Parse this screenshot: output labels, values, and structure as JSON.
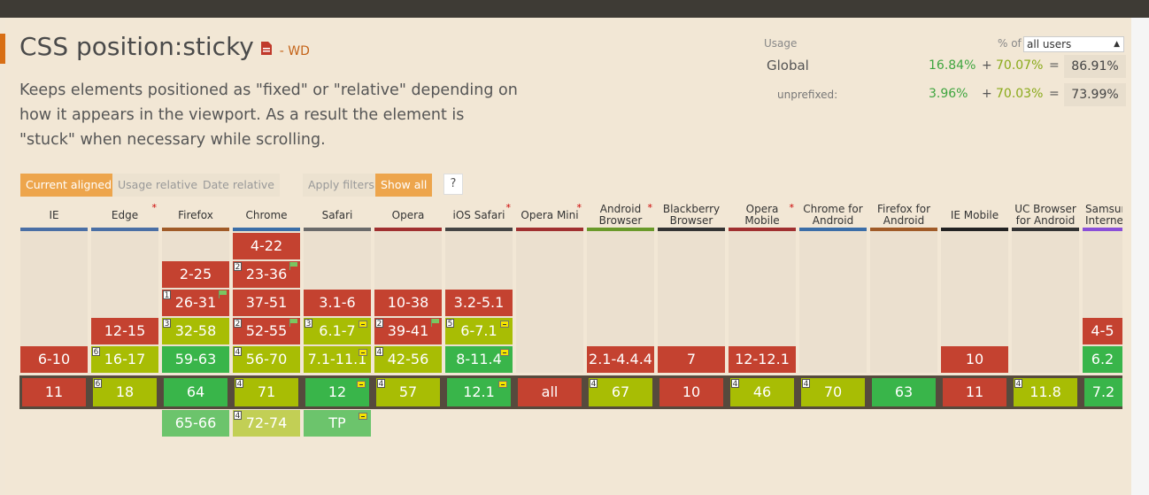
{
  "feature": {
    "title": "CSS position:sticky",
    "status": "- WD",
    "description": "Keeps elements positioned as \"fixed\" or \"relative\" depending on how it appears in the viewport. As a result the element is \"stuck\" when necessary while scrolling."
  },
  "usage": {
    "label": "Usage",
    "pct_of": "% of",
    "select_value": "all users",
    "global": {
      "name": "Global",
      "full": "16.84%",
      "plus": "+",
      "partial": "70.07%",
      "eq": "=",
      "total": "86.91%"
    },
    "unprefixed": {
      "name": "unprefixed:",
      "full": "3.96%",
      "plus": "+",
      "partial": "70.03%",
      "eq": "=",
      "total": "73.99%"
    }
  },
  "toolbar": {
    "current_aligned": "Current aligned",
    "usage_relative": "Usage relative",
    "date_relative": "Date relative",
    "apply_filters": "Apply filters",
    "show_all": "Show all",
    "help": "?"
  },
  "colors": {
    "supported": "#39b54a",
    "partial": "#a8bd04",
    "unsupported": "#c44230",
    "accent": "#eda54c"
  },
  "browsers": [
    {
      "name": "IE",
      "asterisk": false,
      "color": "#4a6fa5",
      "cells": [
        {
          "row": 4,
          "v": "6-10",
          "c": "r"
        }
      ],
      "current": {
        "v": "11",
        "c": "r"
      },
      "future": []
    },
    {
      "name": "Edge",
      "asterisk": true,
      "color": "#4a6fa5",
      "cells": [
        {
          "row": 3,
          "v": "12-15",
          "c": "r"
        },
        {
          "row": 4,
          "v": "16-17",
          "c": "y",
          "note": "6"
        }
      ],
      "current": {
        "v": "18",
        "c": "y",
        "note": "6"
      },
      "future": []
    },
    {
      "name": "Firefox",
      "asterisk": false,
      "color": "#a05b28",
      "cells": [
        {
          "row": 1,
          "v": "2-25",
          "c": "r"
        },
        {
          "row": 2,
          "v": "26-31",
          "c": "r",
          "note": "1",
          "flag": true
        },
        {
          "row": 3,
          "v": "32-58",
          "c": "y",
          "note": "3"
        },
        {
          "row": 4,
          "v": "59-63",
          "c": "g"
        }
      ],
      "current": {
        "v": "64",
        "c": "g"
      },
      "future": [
        {
          "v": "65-66",
          "c": "lg"
        }
      ]
    },
    {
      "name": "Chrome",
      "asterisk": false,
      "color": "#3b6ea8",
      "cells": [
        {
          "row": 0,
          "v": "4-22",
          "c": "r"
        },
        {
          "row": 1,
          "v": "23-36",
          "c": "r",
          "note": "2",
          "flag": true
        },
        {
          "row": 2,
          "v": "37-51",
          "c": "r"
        },
        {
          "row": 3,
          "v": "52-55",
          "c": "r",
          "note": "2",
          "flag": true
        },
        {
          "row": 4,
          "v": "56-70",
          "c": "y",
          "note": "4"
        }
      ],
      "current": {
        "v": "71",
        "c": "y",
        "note": "4"
      },
      "future": [
        {
          "v": "72-74",
          "c": "ly",
          "note": "4"
        }
      ]
    },
    {
      "name": "Safari",
      "asterisk": false,
      "color": "#6a6a6a",
      "cells": [
        {
          "row": 2,
          "v": "3.1-6",
          "c": "r"
        },
        {
          "row": 3,
          "v": "6.1-7",
          "c": "y",
          "note": "3",
          "pf": true
        },
        {
          "row": 4,
          "v": "7.1-11.1",
          "c": "y",
          "pf": true
        }
      ],
      "current": {
        "v": "12",
        "c": "g",
        "pf": true
      },
      "future": [
        {
          "v": "TP",
          "c": "lg",
          "pf": true
        }
      ]
    },
    {
      "name": "Opera",
      "asterisk": false,
      "color": "#a03030",
      "cells": [
        {
          "row": 2,
          "v": "10-38",
          "c": "r"
        },
        {
          "row": 3,
          "v": "39-41",
          "c": "r",
          "note": "2",
          "flag": true
        },
        {
          "row": 4,
          "v": "42-56",
          "c": "y",
          "note": "4"
        }
      ],
      "current": {
        "v": "57",
        "c": "y",
        "note": "4"
      },
      "future": []
    },
    {
      "name": "iOS Safari",
      "asterisk": true,
      "color": "#444444",
      "cells": [
        {
          "row": 2,
          "v": "3.2-5.1",
          "c": "r"
        },
        {
          "row": 3,
          "v": "6-7.1",
          "c": "y",
          "note": "5",
          "pf": true
        },
        {
          "row": 4,
          "v": "8-11.4",
          "c": "g",
          "pf": true
        }
      ],
      "current": {
        "v": "12.1",
        "c": "g",
        "pf": true
      },
      "future": []
    },
    {
      "name": "Opera Mini",
      "asterisk": true,
      "color": "#a03030",
      "cells": [],
      "current": {
        "v": "all",
        "c": "r"
      },
      "future": []
    },
    {
      "name": "Android Browser",
      "asterisk": true,
      "color": "#6a9a2a",
      "cells": [
        {
          "row": 4,
          "v": "2.1-4.4.4",
          "c": "r"
        }
      ],
      "current": {
        "v": "67",
        "c": "y",
        "note": "4"
      },
      "future": []
    },
    {
      "name": "Blackberry Browser",
      "asterisk": false,
      "color": "#333333",
      "cells": [
        {
          "row": 4,
          "v": "7",
          "c": "r"
        }
      ],
      "current": {
        "v": "10",
        "c": "r"
      },
      "future": []
    },
    {
      "name": "Opera Mobile",
      "asterisk": true,
      "color": "#a03030",
      "cells": [
        {
          "row": 4,
          "v": "12-12.1",
          "c": "r"
        }
      ],
      "current": {
        "v": "46",
        "c": "y",
        "note": "4"
      },
      "future": []
    },
    {
      "name": "Chrome for Android",
      "asterisk": false,
      "color": "#3b6ea8",
      "cells": [],
      "current": {
        "v": "70",
        "c": "y",
        "note": "4"
      },
      "future": []
    },
    {
      "name": "Firefox for Android",
      "asterisk": false,
      "color": "#a05b28",
      "cells": [],
      "current": {
        "v": "63",
        "c": "g"
      },
      "future": []
    },
    {
      "name": "IE Mobile",
      "asterisk": false,
      "color": "#222222",
      "cells": [
        {
          "row": 4,
          "v": "10",
          "c": "r"
        }
      ],
      "current": {
        "v": "11",
        "c": "r"
      },
      "future": []
    },
    {
      "name": "UC Browser for Android",
      "asterisk": false,
      "color": "#333333",
      "cells": [],
      "current": {
        "v": "11.8",
        "c": "y",
        "note": "4"
      },
      "future": []
    },
    {
      "name": "Samsung Internet",
      "asterisk": false,
      "color": "#8a4fd8",
      "cells": [
        {
          "row": 3,
          "v": "4-5",
          "c": "r"
        },
        {
          "row": 4,
          "v": "6.2",
          "c": "g"
        }
      ],
      "current": {
        "v": "7.2",
        "c": "g"
      },
      "future": []
    }
  ]
}
